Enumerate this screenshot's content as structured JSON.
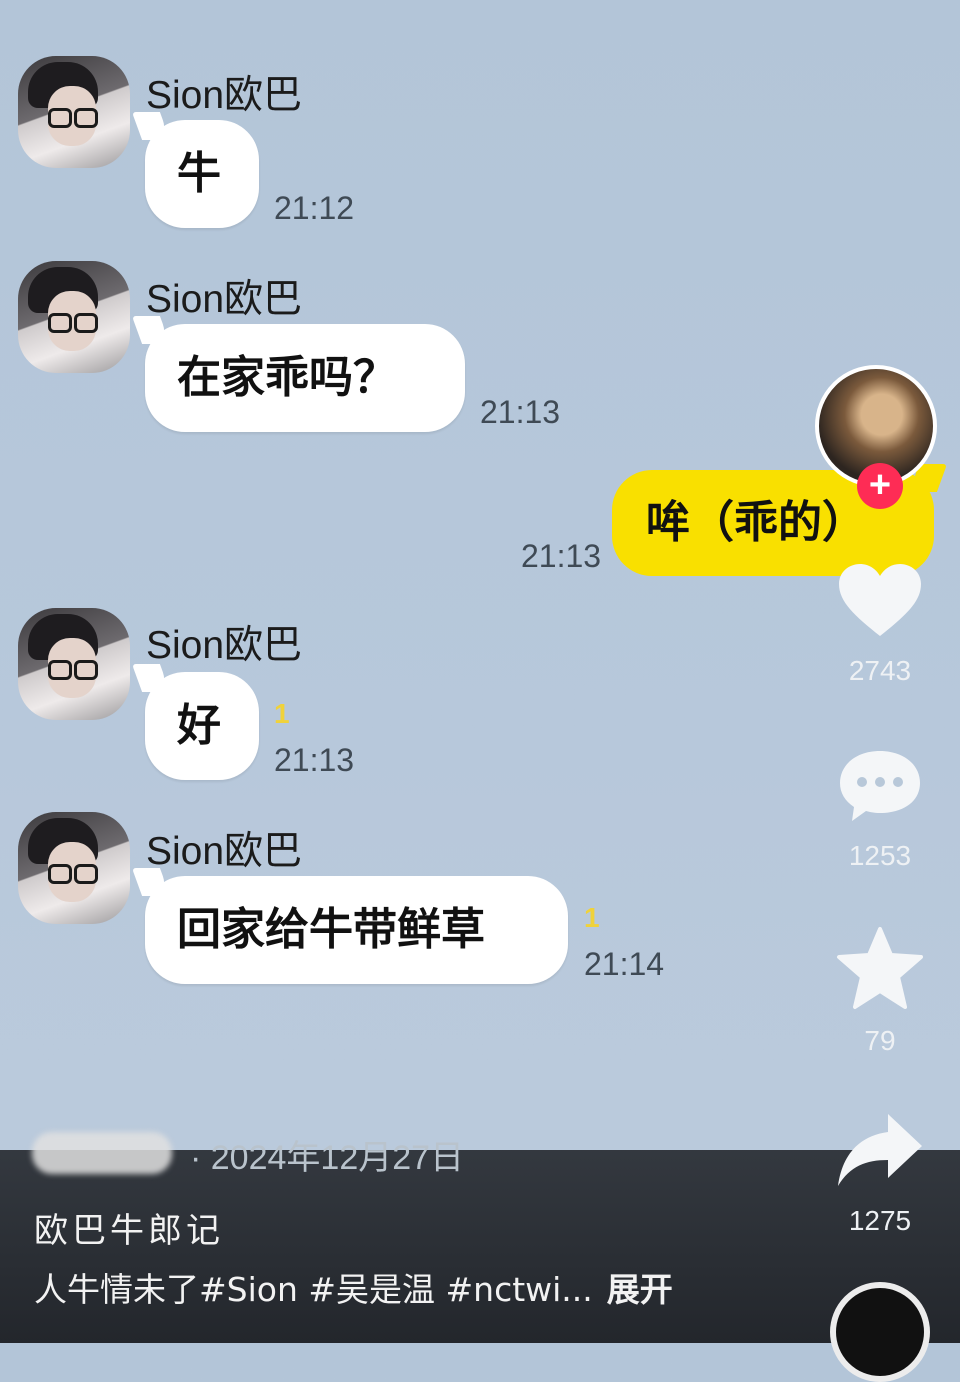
{
  "messages": [
    {
      "sender": "Sion欧巴",
      "text": "牛",
      "time": "21:12"
    },
    {
      "sender": "Sion欧巴",
      "text": "在家乖吗？",
      "time": "21:13"
    },
    {
      "text": "哞（乖的）",
      "time": "21:13"
    },
    {
      "sender": "Sion欧巴",
      "text": "好",
      "time": "21:13",
      "unread": "1"
    },
    {
      "sender": "Sion欧巴",
      "text": "回家给牛带鲜草",
      "time": "21:14",
      "unread": "1"
    }
  ],
  "actions": {
    "likes": "2743",
    "comments": "1253",
    "favorites": "79",
    "shares": "1275",
    "follow_symbol": "+"
  },
  "post": {
    "date": "· 2024年12月27日",
    "title": "欧巴牛郎记",
    "tags_text": "人牛情未了#Sion #吴是温 #nctwi...",
    "expand_label": "展开"
  },
  "icons": {
    "like": "heart-icon",
    "comment": "comment-bubble-icon",
    "favorite": "star-icon",
    "share": "share-arrow-icon"
  },
  "colors": {
    "chat_background": "#b3c5d8",
    "incoming_bubble": "#ffffff",
    "outgoing_bubble": "#f9e000",
    "unread_badge": "#f0d23a",
    "follow_button": "#fe2c55"
  }
}
